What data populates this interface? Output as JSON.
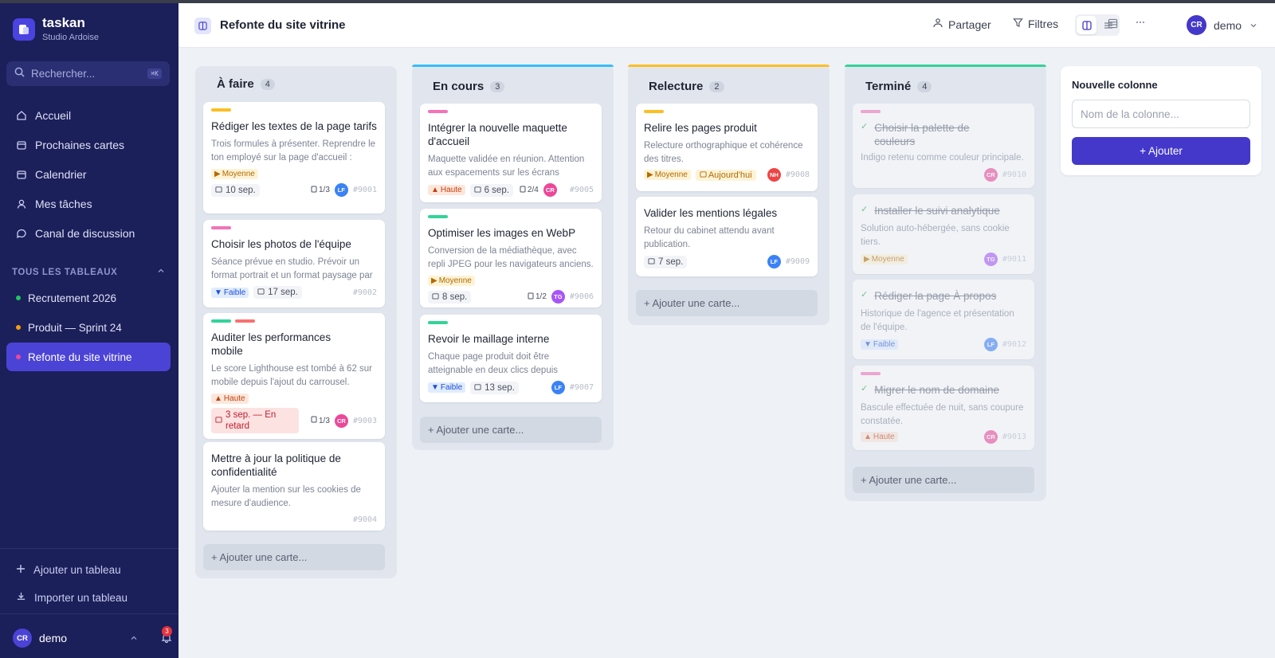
{
  "app": {
    "name": "taskan",
    "workspace": "Studio Ardoise"
  },
  "search": {
    "placeholder": "Rechercher...",
    "shortcut": "⌘K"
  },
  "nav": [
    {
      "label": "Accueil",
      "icon": "home-icon"
    },
    {
      "label": "Prochaines cartes",
      "icon": "calendar-icon"
    },
    {
      "label": "Calendrier",
      "icon": "calendar-icon"
    },
    {
      "label": "Mes tâches",
      "icon": "user-icon"
    },
    {
      "label": "Canal de discussion",
      "icon": "chat-icon"
    }
  ],
  "boards_section": {
    "title": "TOUS LES TABLEAUX"
  },
  "boards": [
    {
      "label": "Recrutement 2026",
      "color": "#22c55e"
    },
    {
      "label": "Produit — Sprint 24",
      "color": "#f59e0b"
    },
    {
      "label": "Refonte du site vitrine",
      "color": "#ec4899",
      "active": true
    }
  ],
  "sidebar_actions": {
    "add_board": "Ajouter un tableau",
    "import_board": "Importer un tableau"
  },
  "user": {
    "initials": "CR",
    "name": "demo",
    "notifications": "3"
  },
  "topbar": {
    "title": "Refonte du site vitrine",
    "share": "Partager",
    "filters": "Filtres",
    "user_initials": "CR",
    "user_name": "demo"
  },
  "columns": [
    {
      "title": "À faire",
      "count": "4",
      "accent": "",
      "add_label": "+ Ajouter une carte...",
      "cards": [
        {
          "title": "Rédiger les textes de la page tarifs",
          "desc": "Trois formules à présenter. Reprendre le ton employé sur la page d'accueil : direct et chaleureux.",
          "priority": "Moyenne",
          "date": "10 sep.",
          "checklist": "1/3",
          "avatar": "LF",
          "id": "#9001"
        },
        {
          "title": "Choisir les photos de l'équipe",
          "desc": "Séance prévue en studio. Prévoir un format portrait et un format paysage par personne.",
          "priority": "Faible",
          "date": "17 sep.",
          "id": "#9002"
        },
        {
          "title": "Auditer les performances mobile",
          "desc": "Le score Lighthouse est tombé à 62 sur mobile depuis l'ajout du carrousel.",
          "priority": "Haute",
          "date": "3 sep. — En retard",
          "checklist": "1/3",
          "avatar": "CR",
          "id": "#9003"
        },
        {
          "title": "Mettre à jour la politique de confidentialité",
          "desc": "Ajouter la mention sur les cookies de mesure d'audience.",
          "id": "#9004"
        }
      ]
    },
    {
      "title": "En cours",
      "count": "3",
      "accent": "#38bdf8",
      "add_label": "+ Ajouter une carte...",
      "cards": [
        {
          "title": "Intégrer la nouvelle maquette d'accueil",
          "desc": "Maquette validée en réunion. Attention aux espacements sur les écrans intermédiaires.",
          "priority": "Haute",
          "date": "6 sep.",
          "checklist": "2/4",
          "avatar": "CR",
          "id": "#9005"
        },
        {
          "title": "Optimiser les images en WebP",
          "desc": "Conversion de la médiathèque, avec repli JPEG pour les navigateurs anciens.",
          "priority": "Moyenne",
          "date": "8 sep.",
          "checklist": "1/2",
          "avatar": "TG",
          "id": "#9006"
        },
        {
          "title": "Revoir le maillage interne",
          "desc": "Chaque page produit doit être atteignable en deux clics depuis l'accueil.",
          "priority": "Faible",
          "date": "13 sep.",
          "avatar": "LF",
          "id": "#9007"
        }
      ]
    },
    {
      "title": "Relecture",
      "count": "2",
      "accent": "#fbbf24",
      "add_label": "+ Ajouter une carte...",
      "cards": [
        {
          "title": "Relire les pages produit",
          "desc": "Relecture orthographique et cohérence des titres.",
          "priority": "Moyenne",
          "date": "Aujourd'hui",
          "avatar": "NH",
          "id": "#9008"
        },
        {
          "title": "Valider les mentions légales",
          "desc": "Retour du cabinet attendu avant publication.",
          "date": "7 sep.",
          "avatar": "LF",
          "id": "#9009"
        }
      ]
    },
    {
      "title": "Terminé",
      "count": "4",
      "accent": "#34d399",
      "add_label": "+ Ajouter une carte...",
      "cards": [
        {
          "title": "Choisir la palette de couleurs",
          "desc": "Indigo retenu comme couleur principale.",
          "avatar": "CR",
          "id": "#9010"
        },
        {
          "title": "Installer le suivi analytique",
          "desc": "Solution auto-hébergée, sans cookie tiers.",
          "priority": "Moyenne",
          "avatar": "TG",
          "id": "#9011"
        },
        {
          "title": "Rédiger la page À propos",
          "desc": "Historique de l'agence et présentation de l'équipe.",
          "priority": "Faible",
          "avatar": "LF",
          "id": "#9012"
        },
        {
          "title": "Migrer le nom de domaine",
          "desc": "Bascule effectuée de nuit, sans coupure constatée.",
          "priority": "Haute",
          "avatar": "CR",
          "id": "#9013"
        }
      ]
    }
  ],
  "new_column": {
    "title": "Nouvelle colonne",
    "placeholder": "Nom de la colonne...",
    "button": "+ Ajouter"
  },
  "colors": {
    "sidebar": "#1b1f5a",
    "accent": "#4338ca",
    "label_yellow": "#fbbf24",
    "label_pink": "#f472b6",
    "label_green": "#34d399",
    "avatar_LF": "#3b82f6",
    "avatar_CR": "#ec4899",
    "avatar_TG": "#a855f7",
    "avatar_NH": "#ef4444"
  }
}
